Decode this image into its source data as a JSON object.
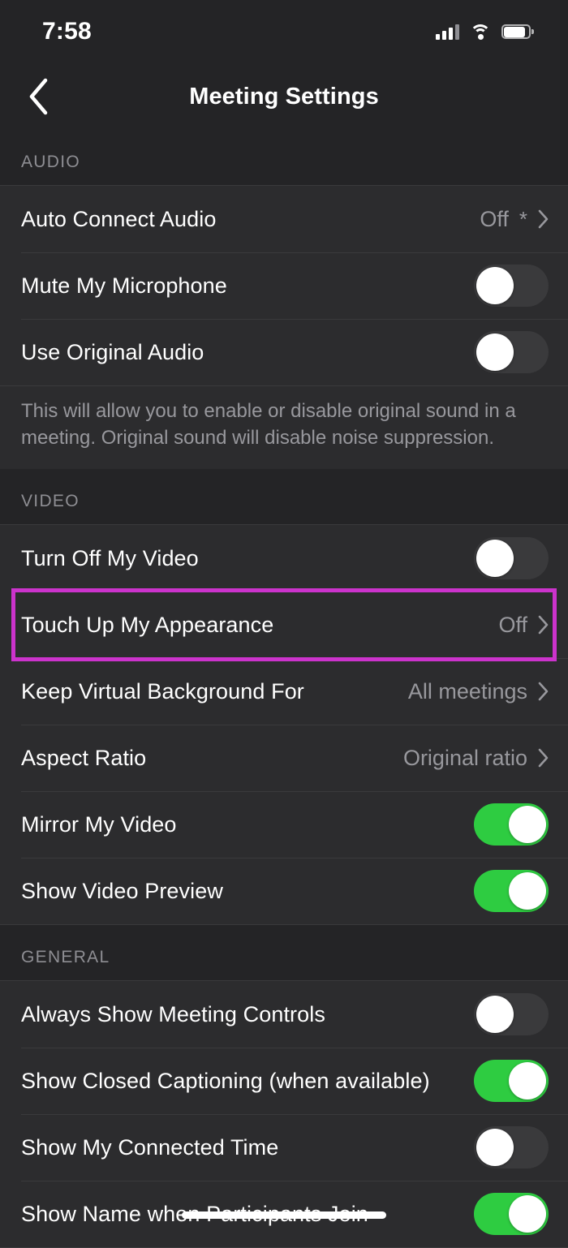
{
  "status_bar": {
    "time": "7:58",
    "cellular_icon": "signal-bars-icon",
    "wifi_icon": "wifi-icon",
    "battery_icon": "battery-icon"
  },
  "nav": {
    "back_icon": "chevron-left-icon",
    "title": "Meeting Settings"
  },
  "colors": {
    "toggle_on": "#2ecc41",
    "toggle_off": "#3a3a3c",
    "highlight": "#cc33cc",
    "row_background": "#2c2c2e",
    "page_background": "#242426",
    "secondary_text": "#98989d"
  },
  "sections": [
    {
      "header": "AUDIO",
      "rows": [
        {
          "label": "Auto Connect Audio",
          "type": "disclosure",
          "value": "Off",
          "asterisk": "*"
        },
        {
          "label": "Mute My Microphone",
          "type": "toggle",
          "on": false
        },
        {
          "label": "Use Original Audio",
          "type": "toggle",
          "on": false
        }
      ],
      "footnote": "This will allow you to enable or disable original sound in a meeting. Original sound will disable noise suppression."
    },
    {
      "header": "VIDEO",
      "rows": [
        {
          "label": "Turn Off My Video",
          "type": "toggle",
          "on": false
        },
        {
          "label": "Touch Up My Appearance",
          "type": "disclosure",
          "value": "Off",
          "highlighted": true
        },
        {
          "label": "Keep Virtual Background For",
          "type": "disclosure",
          "value": "All meetings"
        },
        {
          "label": "Aspect Ratio",
          "type": "disclosure",
          "value": "Original ratio"
        },
        {
          "label": "Mirror My Video",
          "type": "toggle",
          "on": true
        },
        {
          "label": "Show Video Preview",
          "type": "toggle",
          "on": true
        }
      ]
    },
    {
      "header": "GENERAL",
      "rows": [
        {
          "label": "Always Show Meeting Controls",
          "type": "toggle",
          "on": false
        },
        {
          "label": "Show Closed Captioning (when available)",
          "type": "toggle",
          "on": true
        },
        {
          "label": "Show My Connected Time",
          "type": "toggle",
          "on": false
        },
        {
          "label": "Show Name when Participants Join",
          "type": "toggle",
          "on": true
        }
      ]
    }
  ]
}
